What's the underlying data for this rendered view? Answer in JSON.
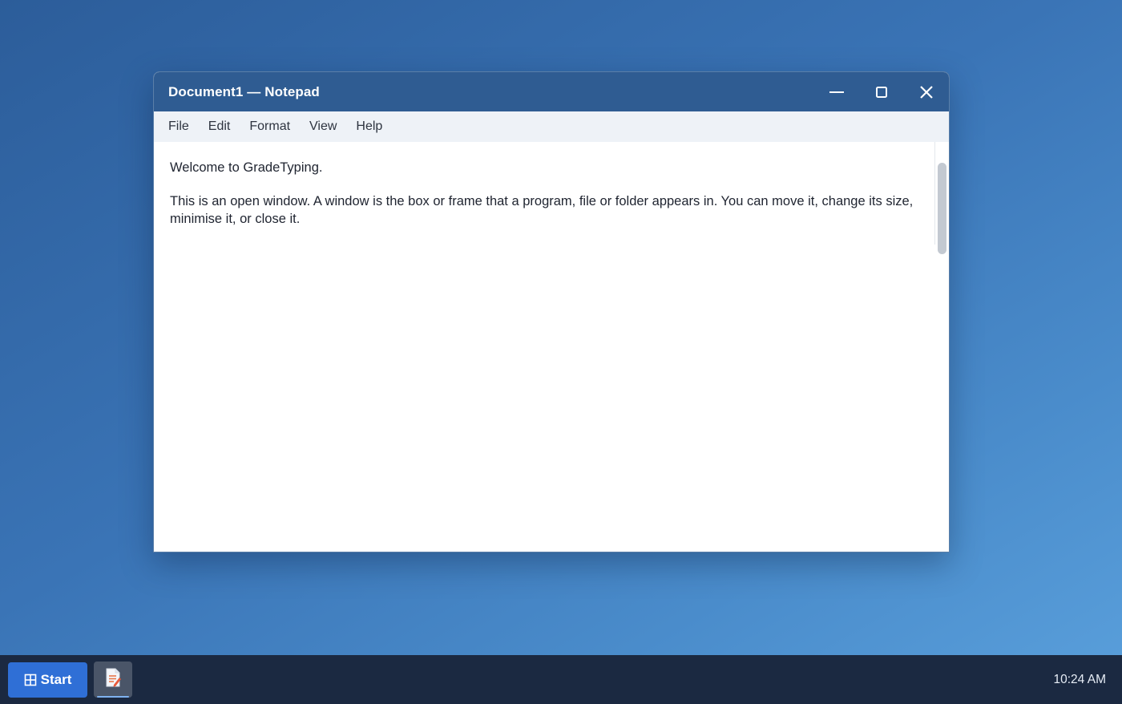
{
  "window": {
    "title": "Document1 — Notepad",
    "controls": {
      "minimize_icon": "minimize-icon",
      "maximize_icon": "maximize-icon",
      "close_icon": "close-icon"
    }
  },
  "menu": {
    "items": [
      {
        "label": "File"
      },
      {
        "label": "Edit"
      },
      {
        "label": "Format"
      },
      {
        "label": "View"
      },
      {
        "label": "Help"
      }
    ]
  },
  "document": {
    "paragraphs": [
      "Welcome to GradeTyping.",
      "This is an open window. A window is the box or frame that a program, file or folder appears in. You can move it, change its size, minimise it, or close it."
    ]
  },
  "taskbar": {
    "start_label": "Start",
    "start_icon": "windows-grid-icon",
    "app_icon": "notepad-icon",
    "clock": "10:24 AM"
  },
  "colors": {
    "titlebar": "#2f5c92",
    "menubar": "#eef2f7",
    "taskbar": "#1b2941",
    "start_button": "#2f6fd6"
  }
}
